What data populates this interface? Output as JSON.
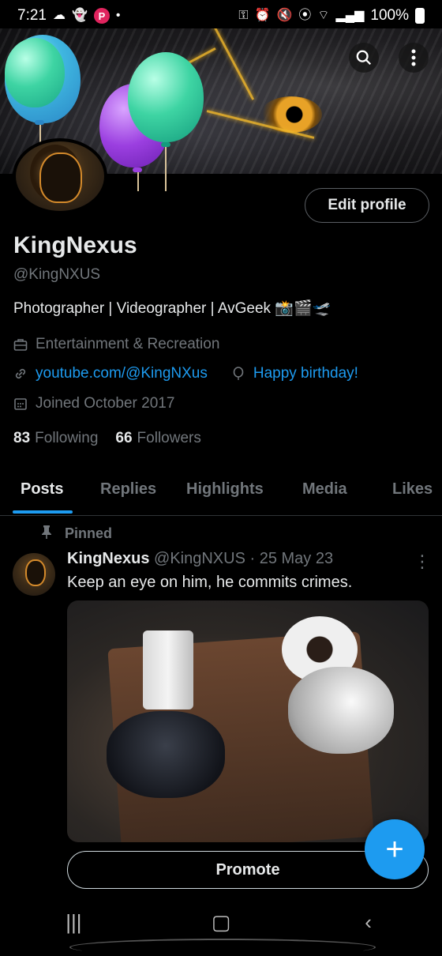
{
  "status_bar": {
    "time": "7:21",
    "battery": "100%",
    "icons": [
      "snapchat-icon",
      "ghost-icon",
      "p-badge-icon",
      "key-icon",
      "alarm-icon",
      "mute-icon",
      "location-icon",
      "wifi-icon",
      "signal-icon",
      "battery-icon"
    ]
  },
  "profile": {
    "name": "KingNexus",
    "handle": "@KingNXUS",
    "edit_button": "Edit profile",
    "bio": "Photographer | Videographer | AvGeek 📸🎬🛫",
    "category": "Entertainment & Recreation",
    "link": "youtube.com/@KingNXus",
    "birthday": "Happy birthday!",
    "joined": "Joined October 2017",
    "following_count": "83",
    "following_label": "Following",
    "followers_count": "66",
    "followers_label": "Followers"
  },
  "tabs": [
    "Posts",
    "Replies",
    "Highlights",
    "Media",
    "Likes"
  ],
  "active_tab": "Posts",
  "pinned_post": {
    "pinned_label": "Pinned",
    "author": "KingNexus",
    "meta": "@KingNXUS · 25 May 23",
    "text": "Keep an eye on him, he commits crimes."
  },
  "promote_button": "Promote",
  "fab_icon": "+",
  "colors": {
    "accent": "#1d9bf0",
    "background": "#000000",
    "text_primary": "#e7e9ea",
    "text_secondary": "#71767b"
  }
}
